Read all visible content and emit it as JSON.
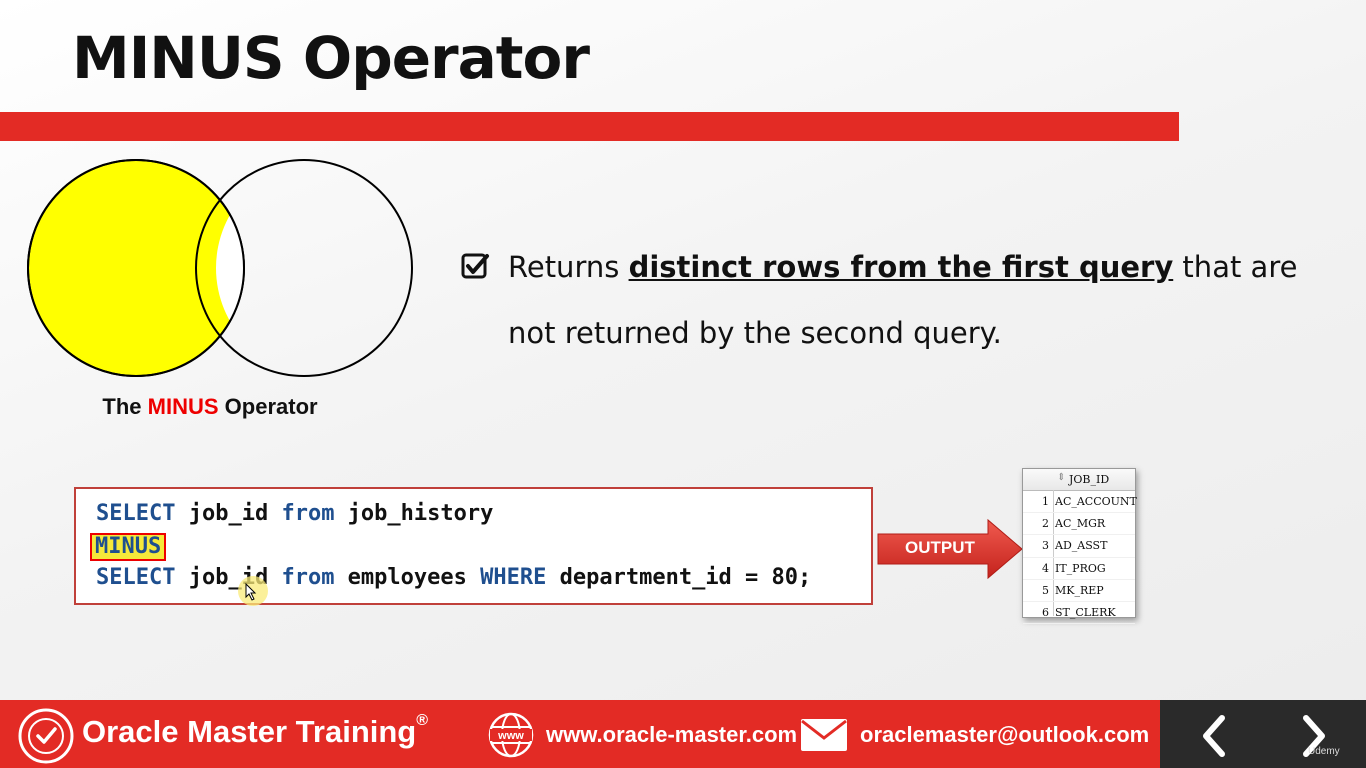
{
  "slide": {
    "title": "MINUS Operator"
  },
  "venn": {
    "caption_prefix": "The ",
    "caption_keyword": "MINUS",
    "caption_suffix": " Operator",
    "fill_color": "#ffff00",
    "stroke_color": "#000000"
  },
  "bullet": {
    "icon": "checkbox-checked-icon",
    "text_before": "Returns ",
    "text_emphasis": "distinct rows from the first query",
    "text_after": " that are not returned by the second query."
  },
  "code": {
    "line1": {
      "kw1": "SELECT",
      "t1": " job_id ",
      "kw2": "from",
      "t2": " job_history"
    },
    "line2": {
      "minus": "MINUS"
    },
    "line3": {
      "kw1": "SELECT",
      "t1": " job_id ",
      "kw2": "from",
      "t2": " employees ",
      "kw3": "WHERE",
      "t3": " department_id = 80;"
    }
  },
  "output_label": "OUTPUT",
  "result": {
    "column": "JOB_ID",
    "rows": [
      {
        "n": "1",
        "v": "AC_ACCOUNT"
      },
      {
        "n": "2",
        "v": "AC_MGR"
      },
      {
        "n": "3",
        "v": "AD_ASST"
      },
      {
        "n": "4",
        "v": "IT_PROG"
      },
      {
        "n": "5",
        "v": "MK_REP"
      },
      {
        "n": "6",
        "v": "ST_CLERK"
      }
    ]
  },
  "footer": {
    "brand": "Oracle Master Training",
    "brand_mark": "®",
    "website": "www.oracle-master.com",
    "email": "oraclemaster@outlook.com",
    "udemy": "Udemy",
    "accent_color": "#e32b25",
    "nav_bg": "#2a2a2a"
  }
}
